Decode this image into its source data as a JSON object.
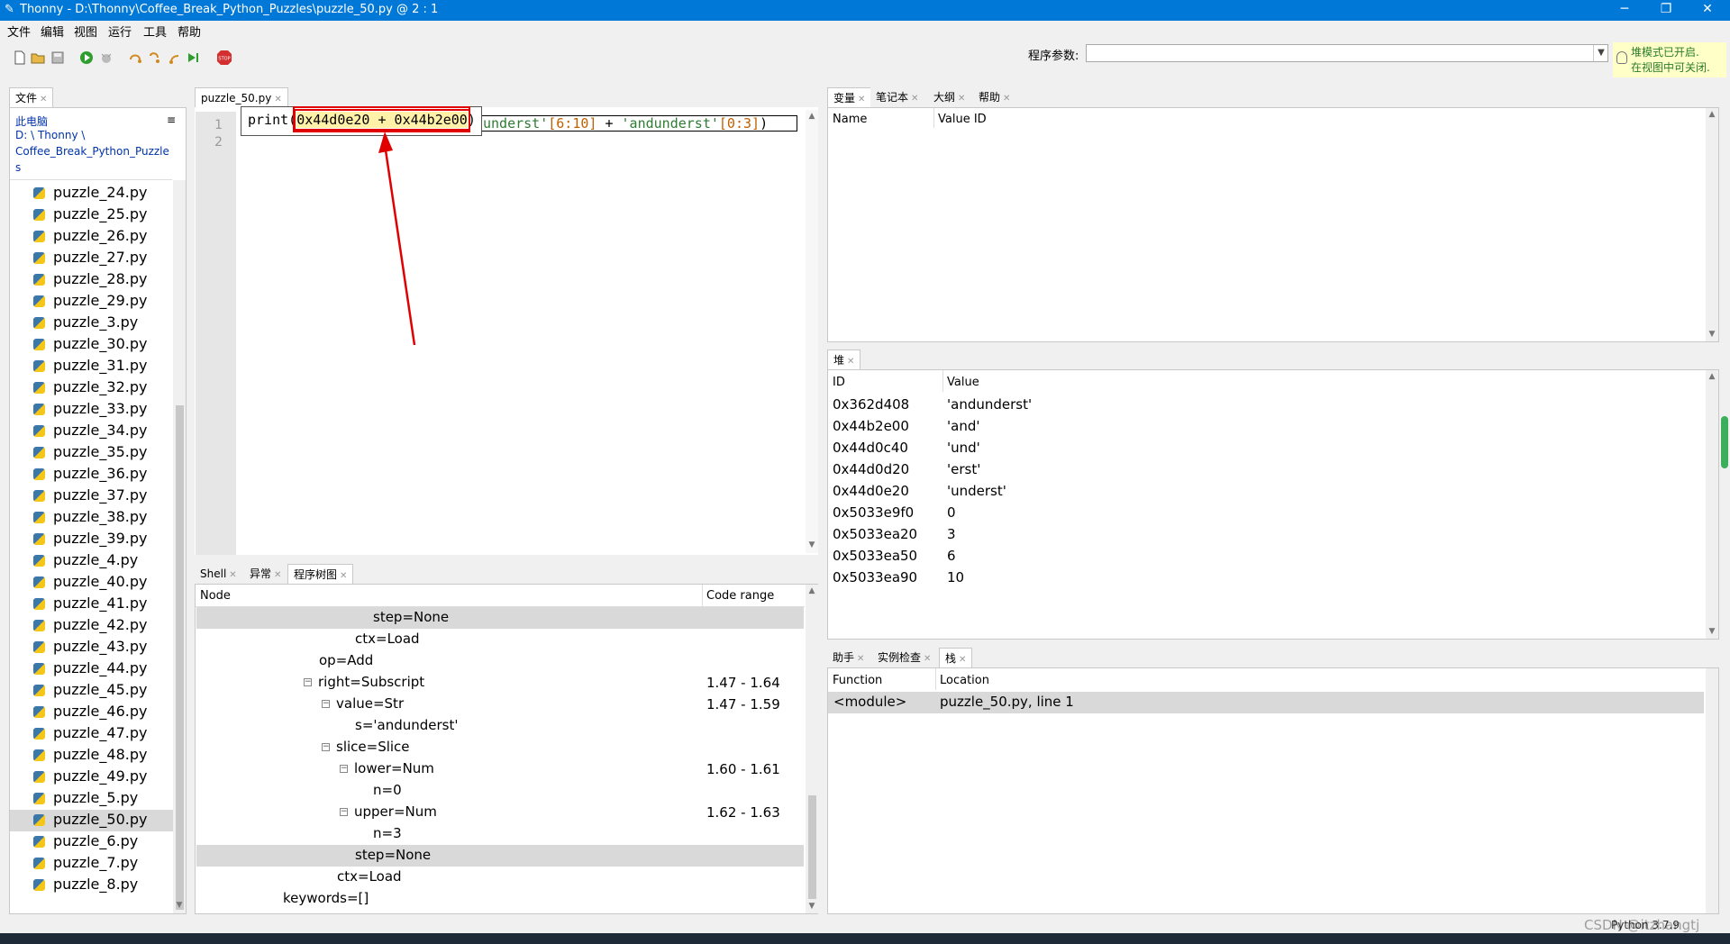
{
  "window": {
    "title": "Thonny  -  D:\\Thonny\\Coffee_Break_Python_Puzzles\\puzzle_50.py  @  2 : 1",
    "minimize": "─",
    "restore": "❐",
    "close": "✕"
  },
  "menu": [
    "文件",
    "编辑",
    "视图",
    "运行",
    "工具",
    "帮助"
  ],
  "toolbar": {
    "args_label": "程序参数:",
    "args_value": "",
    "heap_note_line1": "堆模式已开启.",
    "heap_note_line2": "在视图中可关闭."
  },
  "files_panel": {
    "tab": "文件",
    "root": "此电脑",
    "path_line1": "D: \\ Thonny \\",
    "path_line2": "Coffee_Break_Python_Puzzle",
    "path_line3": "s",
    "files": [
      "puzzle_24.py",
      "puzzle_25.py",
      "puzzle_26.py",
      "puzzle_27.py",
      "puzzle_28.py",
      "puzzle_29.py",
      "puzzle_3.py",
      "puzzle_30.py",
      "puzzle_31.py",
      "puzzle_32.py",
      "puzzle_33.py",
      "puzzle_34.py",
      "puzzle_35.py",
      "puzzle_36.py",
      "puzzle_37.py",
      "puzzle_38.py",
      "puzzle_39.py",
      "puzzle_4.py",
      "puzzle_40.py",
      "puzzle_41.py",
      "puzzle_42.py",
      "puzzle_43.py",
      "puzzle_44.py",
      "puzzle_45.py",
      "puzzle_46.py",
      "puzzle_47.py",
      "puzzle_48.py",
      "puzzle_49.py",
      "puzzle_5.py",
      "puzzle_50.py",
      "puzzle_6.py",
      "puzzle_7.py",
      "puzzle_8.py"
    ],
    "selected": "puzzle_50.py"
  },
  "editor": {
    "tab": "puzzle_50.py",
    "line_numbers": [
      "1",
      "2"
    ],
    "code_print": "print(",
    "code_highlight": "0x44d0e20 + 0x44b2e00",
    "code_close": ")",
    "code_underlying_1": "underst'",
    "code_underlying_2": "[6:10]",
    "code_underlying_3": " + ",
    "code_underlying_4": "'andunderst'",
    "code_underlying_5": "[0:3]",
    "code_underlying_6": ")"
  },
  "bottom_tabs": [
    "Shell",
    "异常",
    "程序树图"
  ],
  "ast": {
    "col_node": "Node",
    "col_range": "Code range",
    "rows": [
      {
        "node": "step=None",
        "range": "",
        "toggle": ""
      },
      {
        "node": "ctx=Load",
        "range": "",
        "toggle": ""
      },
      {
        "node": "op=Add",
        "range": "",
        "toggle": ""
      },
      {
        "node": "right=Subscript",
        "range": "1.47  -  1.64",
        "toggle": "⊟"
      },
      {
        "node": "value=Str",
        "range": "1.47  -  1.59",
        "toggle": "⊟"
      },
      {
        "node": "s='andunderst'",
        "range": "",
        "toggle": ""
      },
      {
        "node": "slice=Slice",
        "range": "",
        "toggle": "⊟"
      },
      {
        "node": "lower=Num",
        "range": "1.60  -  1.61",
        "toggle": "⊟"
      },
      {
        "node": "n=0",
        "range": "",
        "toggle": ""
      },
      {
        "node": "upper=Num",
        "range": "1.62  -  1.63",
        "toggle": "⊟"
      },
      {
        "node": "n=3",
        "range": "",
        "toggle": ""
      },
      {
        "node": "step=None",
        "range": "",
        "toggle": ""
      },
      {
        "node": "ctx=Load",
        "range": "",
        "toggle": ""
      },
      {
        "node": "keywords=[]",
        "range": "",
        "toggle": ""
      }
    ]
  },
  "variables_panel": {
    "tabs": [
      "变量",
      "笔记本",
      "大纲",
      "帮助"
    ],
    "col_name": "Name",
    "col_value_id": "Value ID"
  },
  "heap_panel": {
    "tab": "堆",
    "col_id": "ID",
    "col_value": "Value",
    "rows": [
      {
        "id": "0x362d408",
        "value": "'andunderst'"
      },
      {
        "id": "0x44b2e00",
        "value": "'and'"
      },
      {
        "id": "0x44d0c40",
        "value": "'und'"
      },
      {
        "id": "0x44d0d20",
        "value": "'erst'"
      },
      {
        "id": "0x44d0e20",
        "value": "'underst'"
      },
      {
        "id": "0x5033e9f0",
        "value": "0"
      },
      {
        "id": "0x5033ea20",
        "value": "3"
      },
      {
        "id": "0x5033ea50",
        "value": "6"
      },
      {
        "id": "0x5033ea90",
        "value": "10"
      }
    ]
  },
  "stack_panel": {
    "tabs": [
      "助手",
      "实例检查",
      "栈"
    ],
    "col_function": "Function",
    "col_location": "Location",
    "rows": [
      {
        "function": "<module>",
        "location": "puzzle_50.py, line 1"
      }
    ]
  },
  "status": {
    "python_version": "Python 3.7.9",
    "watermark": "CSDN @itzhangtj"
  },
  "colors": {
    "titlebar": "#0078d7",
    "highlight_box": "#e00000",
    "arrow": "#e00000",
    "string_green": "#2e7d32",
    "number_orange": "#c06000"
  }
}
